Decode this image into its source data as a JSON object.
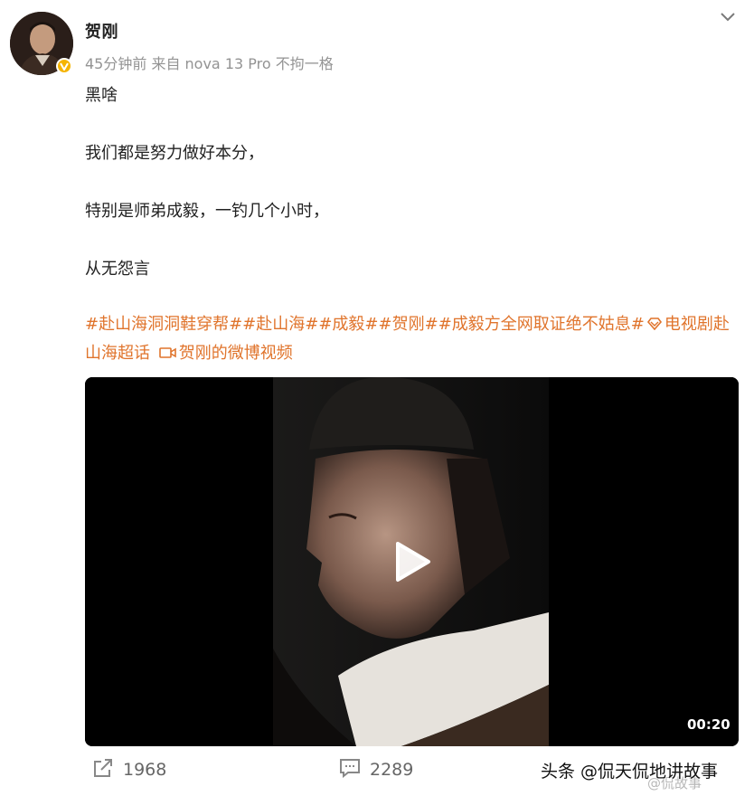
{
  "post": {
    "author": "贺刚",
    "meta": "45分钟前 来自 nova 13 Pro 不拘一格",
    "paragraphs": [
      "黑啥",
      "我们都是努力做好本分，",
      "特别是师弟成毅，一钓几个小时，",
      "从无怨言"
    ],
    "tags": [
      "#赴山海洞洞鞋穿帮#",
      "#赴山海#",
      "#成毅#",
      "#贺刚#",
      "#成毅方全网取证绝不姑息#",
      "电视剧赴山海超话",
      "贺刚的微博视频"
    ]
  },
  "video": {
    "duration": "00:20"
  },
  "actions": {
    "repost_count": "1968",
    "comment_count": "2289"
  },
  "watermark": {
    "text": "头条 @侃天侃地讲故事",
    "handle": "@侃故事"
  },
  "colors": {
    "tag": "#e0742c",
    "verified": "#f5b400",
    "meta": "#939393"
  },
  "icons": [
    "verified-badge-icon",
    "chevron-down-icon",
    "supertopic-icon",
    "video-camera-icon",
    "play-icon",
    "repost-icon",
    "comment-icon"
  ]
}
